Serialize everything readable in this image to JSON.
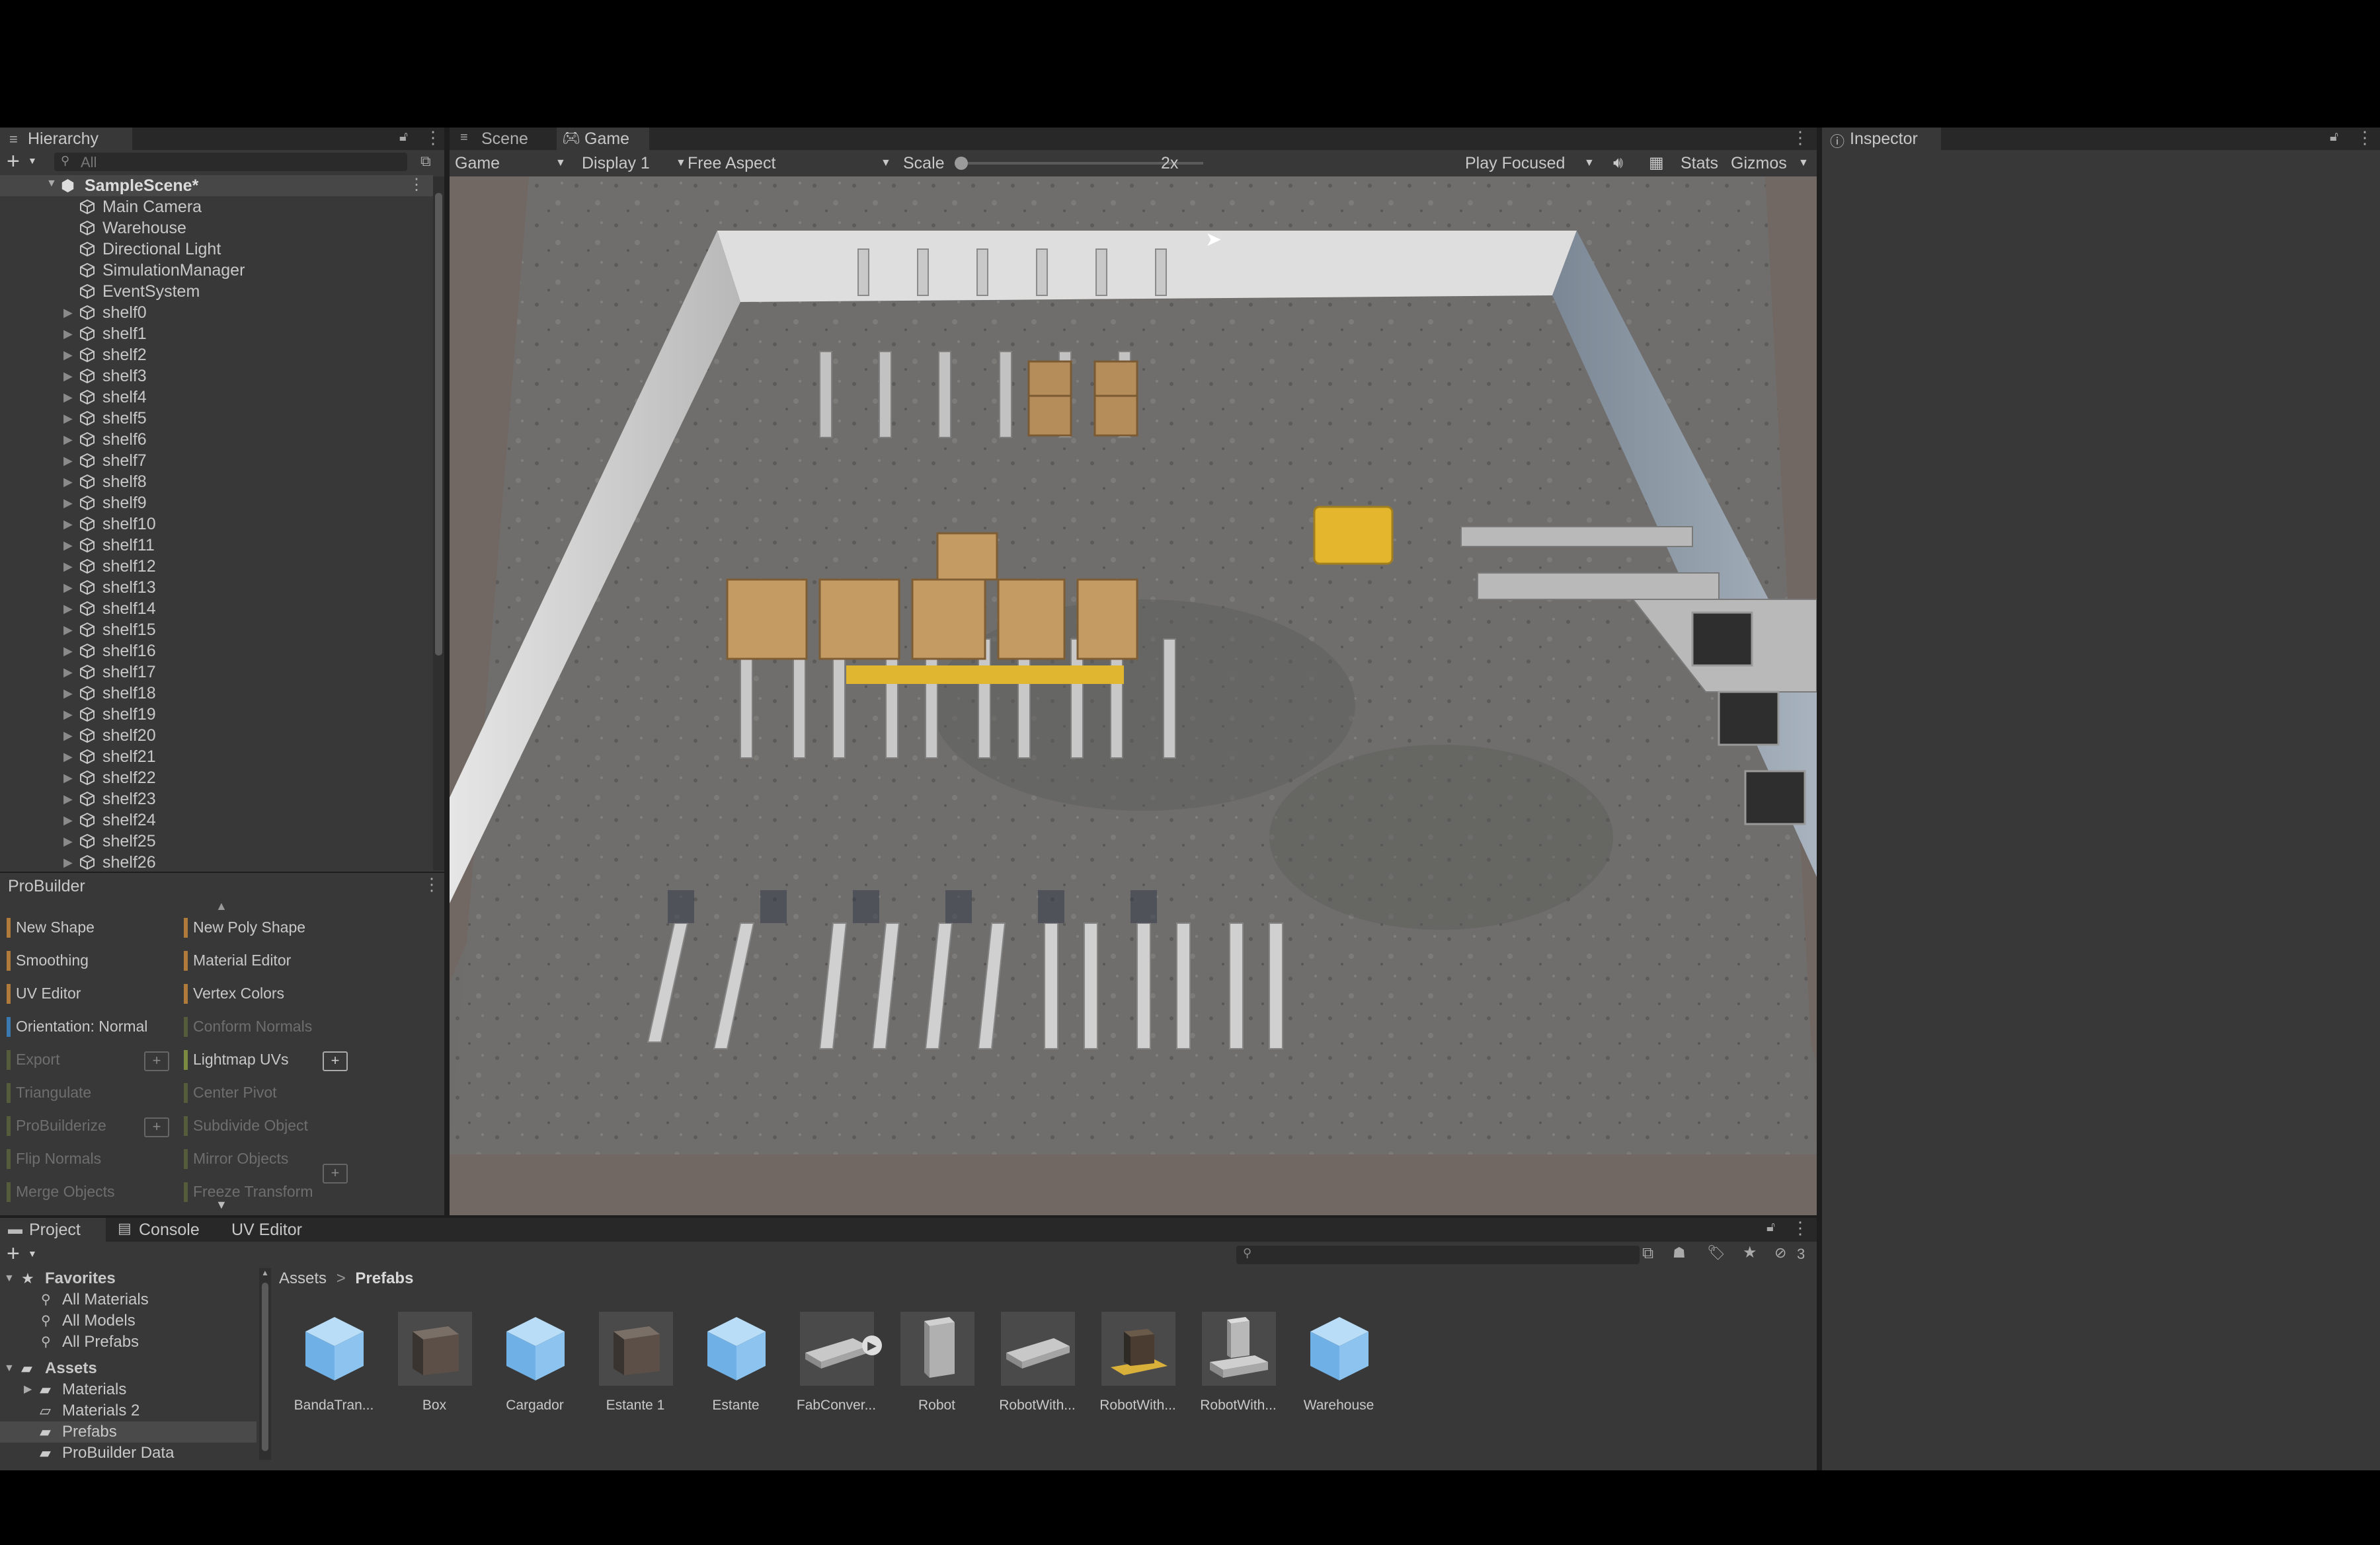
{
  "hierarchy": {
    "tab": "Hierarchy",
    "search_placeholder": "All",
    "scene_name": "SampleScene*",
    "top_items": [
      "Main Camera",
      "Warehouse",
      "Directional Light",
      "SimulationManager",
      "EventSystem"
    ],
    "shelves": [
      "shelf0",
      "shelf1",
      "shelf2",
      "shelf3",
      "shelf4",
      "shelf5",
      "shelf6",
      "shelf7",
      "shelf8",
      "shelf9",
      "shelf10",
      "shelf11",
      "shelf12",
      "shelf13",
      "shelf14",
      "shelf15",
      "shelf16",
      "shelf17",
      "shelf18",
      "shelf19",
      "shelf20",
      "shelf21",
      "shelf22",
      "shelf23",
      "shelf24",
      "shelf25",
      "shelf26"
    ]
  },
  "probuilder": {
    "tab": "ProBuilder",
    "left": [
      "New Shape",
      "Smoothing",
      "UV Editor",
      "Orientation: Normal",
      "Export",
      "Triangulate",
      "ProBuilderize",
      "Flip Normals",
      "Merge Objects"
    ],
    "right": [
      "New Poly Shape",
      "Material Editor",
      "Vertex Colors",
      "Conform Normals",
      "Lightmap UVs",
      "Center Pivot",
      "Subdivide Object",
      "Mirror Objects",
      "Freeze Transform"
    ],
    "plus": "+"
  },
  "view": {
    "tabs": [
      "Scene",
      "Game"
    ],
    "game_dropdown": "Game",
    "display": "Display 1",
    "aspect": "Free Aspect",
    "scale_label": "Scale",
    "scale_value": "2x",
    "play_mode": "Play Focused",
    "stats": "Stats",
    "gizmos": "Gizmos"
  },
  "inspector": {
    "tab": "Inspector"
  },
  "project": {
    "tabs": [
      "Project",
      "Console",
      "UV Editor"
    ],
    "favorites_label": "Favorites",
    "favorites": [
      "All Materials",
      "All Models",
      "All Prefabs"
    ],
    "assets_label": "Assets",
    "folders": [
      "Materials",
      "Materials 2",
      "Prefabs",
      "ProBuilder Data"
    ],
    "breadcrumb": [
      "Assets",
      "Prefabs"
    ],
    "badge_count": "3",
    "items": [
      {
        "name": "BandaTran...",
        "icon": "prefab-cube-icon"
      },
      {
        "name": "Box",
        "icon": "box-thumbnail-icon"
      },
      {
        "name": "Cargador",
        "icon": "prefab-cube-icon"
      },
      {
        "name": "Estante 1",
        "icon": "box-thumbnail-icon"
      },
      {
        "name": "Estante",
        "icon": "prefab-cube-icon"
      },
      {
        "name": "FabConver...",
        "icon": "conveyor-thumbnail-icon"
      },
      {
        "name": "Robot",
        "icon": "robot-thumbnail-icon"
      },
      {
        "name": "RobotWith...",
        "icon": "conveyor-thumbnail-icon"
      },
      {
        "name": "RobotWith...",
        "icon": "robot-box-thumbnail-icon"
      },
      {
        "name": "RobotWith...",
        "icon": "robot-platform-thumbnail-icon"
      },
      {
        "name": "Warehouse",
        "icon": "prefab-cube-icon"
      }
    ]
  }
}
